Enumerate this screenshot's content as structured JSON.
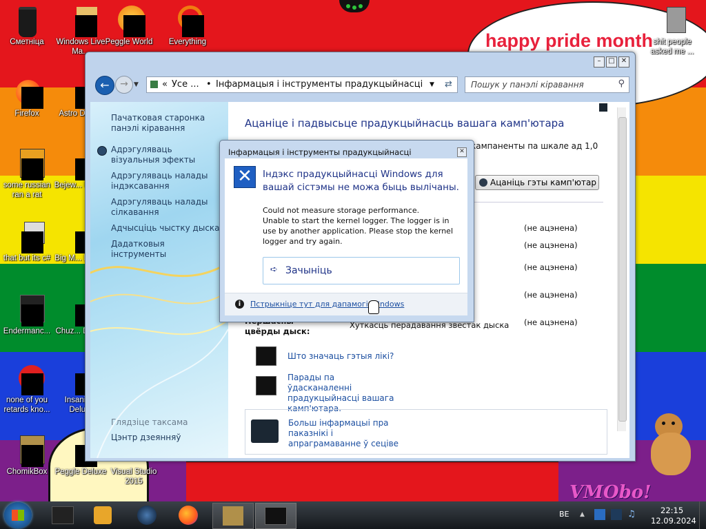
{
  "desktop_icons": [
    {
      "id": "recycle",
      "label": "Сметніца"
    },
    {
      "id": "wlm",
      "label": "Windows Live Ma..."
    },
    {
      "id": "peggle-world",
      "label": "Peggle World"
    },
    {
      "id": "everything",
      "label": "Everything"
    },
    {
      "id": "firefox",
      "label": "Firefox"
    },
    {
      "id": "astro",
      "label": "Astro Delu..."
    },
    {
      "id": "some-russian",
      "label": "some russian ran a rat"
    },
    {
      "id": "bejeweled",
      "label": "Bejew... Delu..."
    },
    {
      "id": "that-but",
      "label": "that but its c#"
    },
    {
      "id": "bigmoney",
      "label": "Big M... Delu..."
    },
    {
      "id": "endermanch",
      "label": "Endermanc..."
    },
    {
      "id": "chuzzle",
      "label": "Chuz... Delu..."
    },
    {
      "id": "none-of-you",
      "label": "none of you retards kno..."
    },
    {
      "id": "insaniquarium",
      "label": "Insaniq... Delu..."
    },
    {
      "id": "chomikbox",
      "label": "ChomikBox"
    },
    {
      "id": "peggle-deluxe",
      "label": "Peggle Deluxe"
    },
    {
      "id": "visual-studio",
      "label": "Visual Studio 2015"
    },
    {
      "id": "shit-people",
      "label": "shit people asked me ..."
    }
  ],
  "bubble_text": "happy pride month",
  "watermark": "VMOboi",
  "window": {
    "breadcrumb_root": "Усе ...",
    "breadcrumb_sep": "•",
    "breadcrumb_current": "Інфармацыя і інструменты прадукцыйнасці",
    "search_placeholder": "Пошук у панэлі кіравання",
    "nav_links": [
      "Пачатковая старонка панэлі кіравання",
      "Адрэгуляваць візуальныя эфекты",
      "Адрэгуляваць налады індэксавання",
      "Адрэгуляваць налады сілкавання",
      "Адчысціць чыстку дыска",
      "Дадатковыя інструменты"
    ],
    "see_also_label": "Глядзіце таксама",
    "see_also_link": "Цэнтр дзеянняў",
    "heading": "Ацаніце і падвысьце прадукцыйнасць вашага камп'ютара",
    "partial_text": "кампаненты па шкале ад 1,0",
    "rate_button": "Ацаніць гэты камп'ютар",
    "row_values": [
      "(не ацэнена)",
      "(не ацэнена)",
      "(не ацэнена)",
      "(не ацэнена)",
      "(не ацэнена)"
    ],
    "disk_label": "Першасны цвёрды дыск:",
    "disk_desc": "Хуткасць перадавання звестак дыска",
    "link_numbers": "Што значаць гэтыя лікі?",
    "link_tips": "Парады па ўдасканаленні прадукцыйнасці вашага камп'ютара.",
    "link_more": "Больш інфармацыі пра паказнікі і апраграмаванне ў сеціве"
  },
  "dialog": {
    "title": "Інфармацыя і інструменты прадукцыйнасці",
    "main_instruction": "Індэкс прадукцыйнасці Windows для вашай сістэмы не можа быць вылічаны.",
    "message": "Could not measure storage performance.\nUnable to start the kernel logger. The logger is in use by another application. Please stop the kernel logger and try again.",
    "close_button": "Зачыніць",
    "help_link": "Пстрыкніце тут для дапамогі Windows"
  },
  "taskbar": {
    "language": "BE",
    "time": "22:15",
    "date": "12.09.2024"
  },
  "colors": {
    "accent": "#1e3287",
    "link": "#1b4ea0",
    "pride_text": "#e8213c"
  }
}
